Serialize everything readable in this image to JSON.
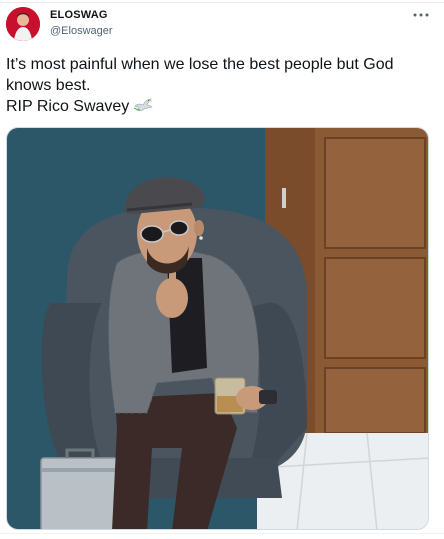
{
  "tweet": {
    "display_name": "ELOSWAG",
    "handle": "@Eloswager",
    "text_line_1": "It’s most painful when we lose the best people but God",
    "text_line_2": "knows best.",
    "text_line_3": "RIP Rico Swavey",
    "emoji": "dove-emoji",
    "more_icon": "more-horizontal-icon",
    "media_description": "photo"
  },
  "colors": {
    "text_primary": "#0f1419",
    "text_secondary": "#536471",
    "avatar_bg": "#c8102e",
    "wall_teal": "#2f5d6f",
    "chair_gray": "#4a5560",
    "door_wood": "#8a5a35"
  }
}
